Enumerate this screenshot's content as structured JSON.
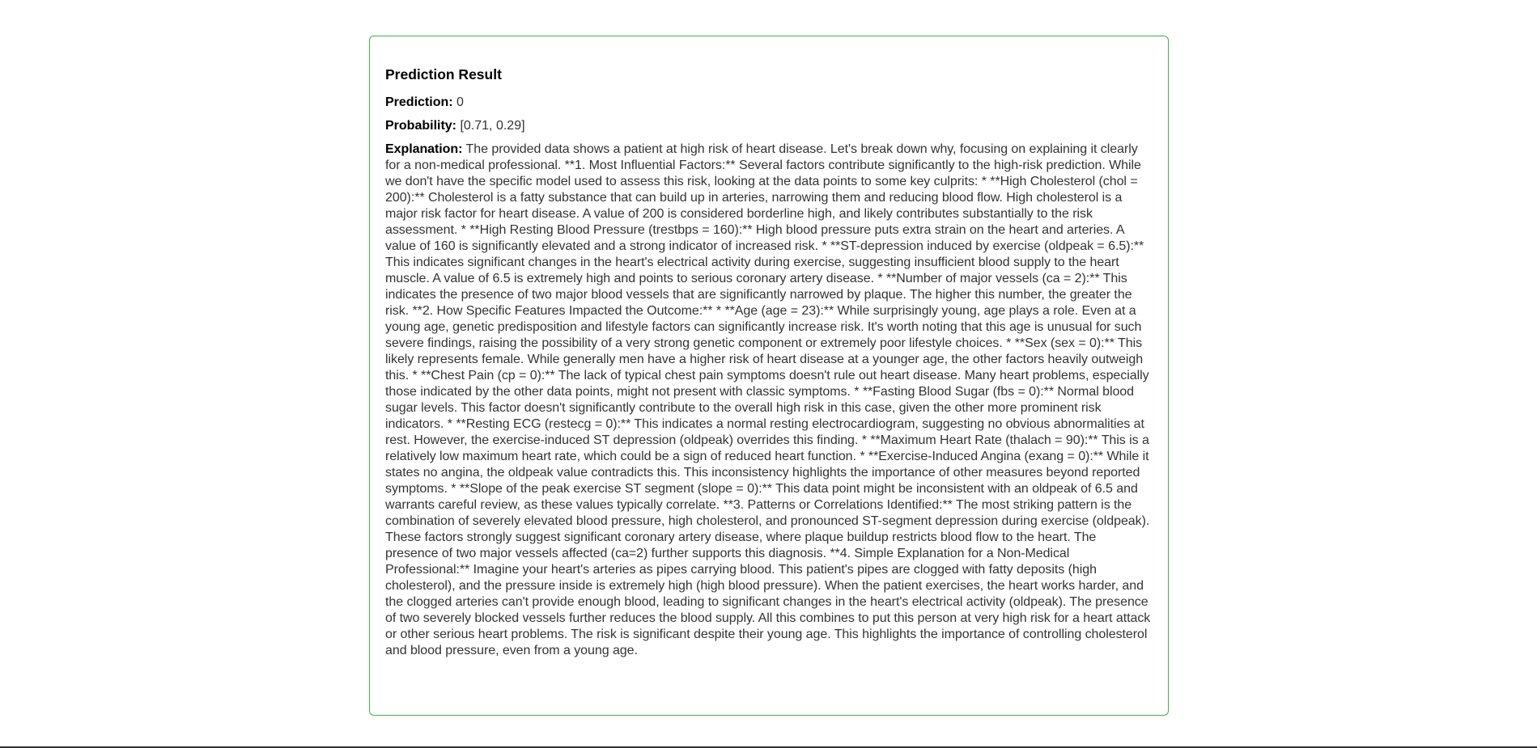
{
  "result": {
    "title": "Prediction Result",
    "prediction_label": "Prediction:",
    "prediction_value": "0",
    "probability_label": "Probability:",
    "probability_value": "[0.71, 0.29]",
    "explanation_label": "Explanation:",
    "explanation_text": "The provided data shows a patient at high risk of heart disease. Let's break down why, focusing on explaining it clearly for a non-medical professional. **1. Most Influential Factors:** Several factors contribute significantly to the high-risk prediction. While we don't have the specific model used to assess this risk, looking at the data points to some key culprits: * **High Cholesterol (chol = 200):** Cholesterol is a fatty substance that can build up in arteries, narrowing them and reducing blood flow. High cholesterol is a major risk factor for heart disease. A value of 200 is considered borderline high, and likely contributes substantially to the risk assessment. * **High Resting Blood Pressure (trestbps = 160):** High blood pressure puts extra strain on the heart and arteries. A value of 160 is significantly elevated and a strong indicator of increased risk. * **ST-depression induced by exercise (oldpeak = 6.5):** This indicates significant changes in the heart's electrical activity during exercise, suggesting insufficient blood supply to the heart muscle. A value of 6.5 is extremely high and points to serious coronary artery disease. * **Number of major vessels (ca = 2):** This indicates the presence of two major blood vessels that are significantly narrowed by plaque. The higher this number, the greater the risk. **2. How Specific Features Impacted the Outcome:** * **Age (age = 23):** While surprisingly young, age plays a role. Even at a young age, genetic predisposition and lifestyle factors can significantly increase risk. It's worth noting that this age is unusual for such severe findings, raising the possibility of a very strong genetic component or extremely poor lifestyle choices. * **Sex (sex = 0):** This likely represents female. While generally men have a higher risk of heart disease at a younger age, the other factors heavily outweigh this. * **Chest Pain (cp = 0):** The lack of typical chest pain symptoms doesn't rule out heart disease. Many heart problems, especially those indicated by the other data points, might not present with classic symptoms. * **Fasting Blood Sugar (fbs = 0):** Normal blood sugar levels. This factor doesn't significantly contribute to the overall high risk in this case, given the other more prominent risk indicators. * **Resting ECG (restecg = 0):** This indicates a normal resting electrocardiogram, suggesting no obvious abnormalities at rest. However, the exercise-induced ST depression (oldpeak) overrides this finding. * **Maximum Heart Rate (thalach = 90):** This is a relatively low maximum heart rate, which could be a sign of reduced heart function. * **Exercise-Induced Angina (exang = 0):** While it states no angina, the oldpeak value contradicts this. This inconsistency highlights the importance of other measures beyond reported symptoms. * **Slope of the peak exercise ST segment (slope = 0):** This data point might be inconsistent with an oldpeak of 6.5 and warrants careful review, as these values typically correlate. **3. Patterns or Correlations Identified:** The most striking pattern is the combination of severely elevated blood pressure, high cholesterol, and pronounced ST-segment depression during exercise (oldpeak). These factors strongly suggest significant coronary artery disease, where plaque buildup restricts blood flow to the heart. The presence of two major vessels affected (ca=2) further supports this diagnosis. **4. Simple Explanation for a Non-Medical Professional:** Imagine your heart's arteries as pipes carrying blood. This patient's pipes are clogged with fatty deposits (high cholesterol), and the pressure inside is extremely high (high blood pressure). When the patient exercises, the heart works harder, and the clogged arteries can't provide enough blood, leading to significant changes in the heart's electrical activity (oldpeak). The presence of two severely blocked vessels further reduces the blood supply. All this combines to put this person at very high risk for a heart attack or other serious heart problems. The risk is significant despite their young age. This highlights the importance of controlling cholesterol and blood pressure, even from a young age."
  },
  "colors": {
    "card_border": "#4caf50",
    "text": "#333333",
    "label": "#000000"
  }
}
